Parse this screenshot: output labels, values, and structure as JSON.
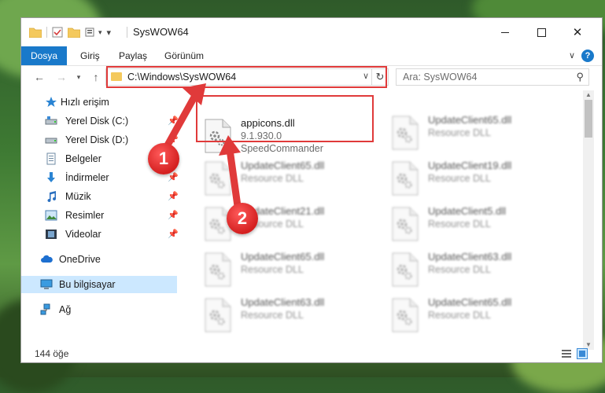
{
  "window": {
    "title": "SysWOW64"
  },
  "ribbon": {
    "tabs": [
      "Dosya",
      "Giriş",
      "Paylaş",
      "Görünüm"
    ],
    "help": "?"
  },
  "nav": {
    "address": "C:\\Windows\\SysWOW64",
    "search_placeholder": "Ara: SysWOW64"
  },
  "sidebar": {
    "items": [
      {
        "label": "Hızlı erişim",
        "icon": "star-icon"
      },
      {
        "label": "Yerel Disk (C:)",
        "icon": "drive-icon",
        "pinned": true
      },
      {
        "label": "Yerel Disk (D:)",
        "icon": "drive-icon",
        "pinned": true
      },
      {
        "label": "Belgeler",
        "icon": "documents-icon",
        "pinned": true
      },
      {
        "label": "İndirmeler",
        "icon": "download-icon",
        "pinned": true
      },
      {
        "label": "Müzik",
        "icon": "music-icon",
        "pinned": true
      },
      {
        "label": "Resimler",
        "icon": "pictures-icon",
        "pinned": true
      },
      {
        "label": "Videolar",
        "icon": "videos-icon",
        "pinned": true
      },
      {
        "label": "OneDrive",
        "icon": "cloud-icon"
      },
      {
        "label": "Bu bilgisayar",
        "icon": "computer-icon",
        "selected": true
      },
      {
        "label": "Ağ",
        "icon": "network-icon"
      }
    ]
  },
  "files": [
    {
      "name": "appicons.dll",
      "line2": "9.1.930.0",
      "line3": "SpeedCommander"
    },
    {
      "name": "UpdateClient65.dll",
      "line2": "Resource DLL"
    },
    {
      "name": "UpdateClient65.dll",
      "line2": "Resource DLL"
    },
    {
      "name": "UpdateClient19.dll",
      "line2": "Resource DLL"
    },
    {
      "name": "UpdateClient21.dll",
      "line2": "Resource DLL"
    },
    {
      "name": "UpdateClient5.dll",
      "line2": "Resource DLL"
    },
    {
      "name": "UpdateClient65.dll",
      "line2": "Resource DLL"
    },
    {
      "name": "UpdateClient63.dll",
      "line2": "Resource DLL"
    },
    {
      "name": "UpdateClient63.dll",
      "line2": "Resource DLL"
    },
    {
      "name": "UpdateClient65.dll",
      "line2": "Resource DLL"
    }
  ],
  "status": {
    "count": "144 öğe"
  },
  "annotations": {
    "badge1": "1",
    "badge2": "2"
  },
  "colors": {
    "accent": "#1979ca",
    "highlight": "#e03a3a",
    "selected": "#cce8ff"
  }
}
